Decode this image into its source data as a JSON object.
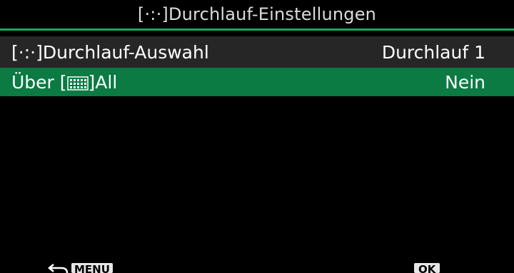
{
  "title": {
    "prefix": "[·:·]",
    "text": "Durchlauf-Einstellungen"
  },
  "rows": [
    {
      "label_prefix": "[·:·]",
      "label": "Durchlauf-Auswahl",
      "value": "Durchlauf 1",
      "selected": false
    },
    {
      "label_before": "Über [",
      "label_after": "]All",
      "value": "Nein",
      "selected": true
    }
  ],
  "footer": {
    "back_icon": "back-arrow-icon",
    "menu_key": "MENU",
    "ok_key": "OK"
  },
  "colors": {
    "accent_green": "#0b7a43",
    "rule_green": "#1aa85a",
    "row_bg": "#262626"
  }
}
